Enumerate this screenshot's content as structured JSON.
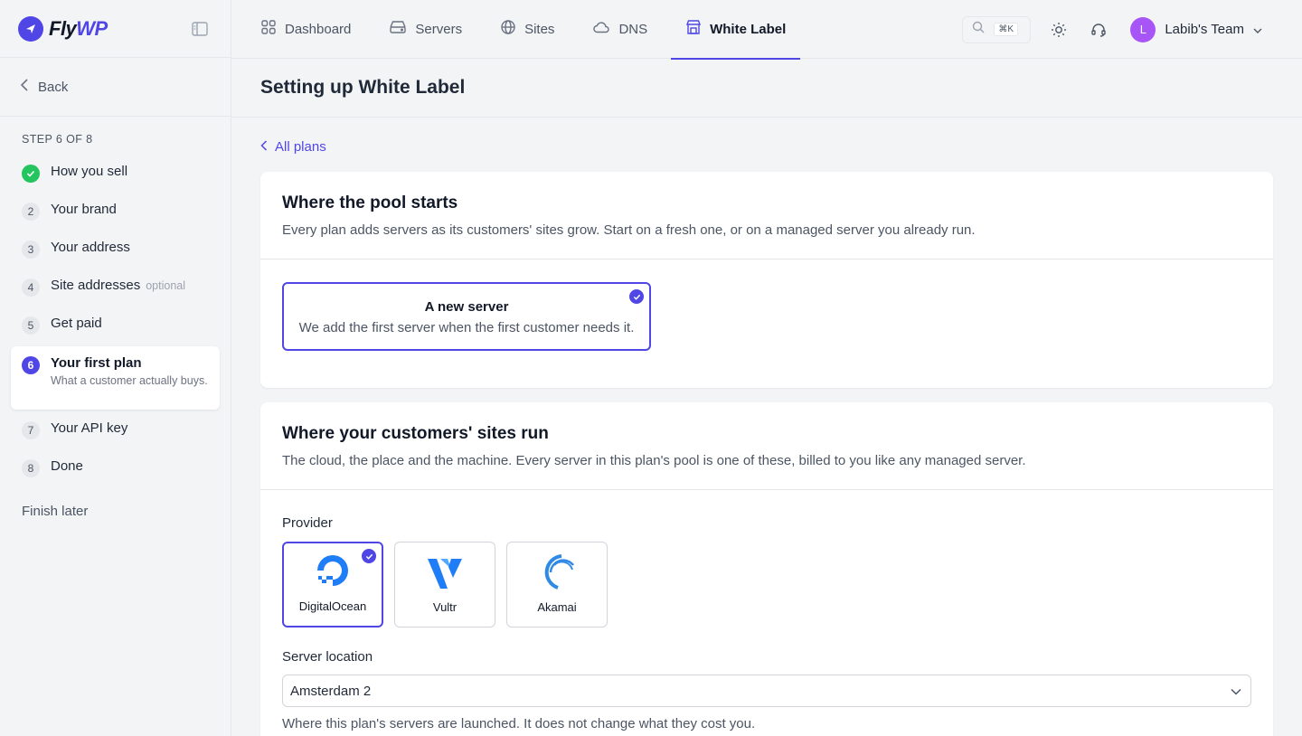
{
  "brand": {
    "name_main": "Fly",
    "name_accent": "WP",
    "accent": "#4f46e5"
  },
  "sidebar": {
    "back_label": "Back",
    "step_count": "STEP 6 OF 8",
    "steps": [
      {
        "num": "",
        "label": "How you sell",
        "state": "done"
      },
      {
        "num": "2",
        "label": "Your brand",
        "state": "todo"
      },
      {
        "num": "3",
        "label": "Your address",
        "state": "todo"
      },
      {
        "num": "4",
        "label": "Site addresses",
        "optional": "optional",
        "state": "todo"
      },
      {
        "num": "5",
        "label": "Get paid",
        "state": "todo"
      },
      {
        "num": "6",
        "label": "Your first plan",
        "sub": "What a customer actually buys.",
        "state": "active"
      },
      {
        "num": "7",
        "label": "Your API key",
        "state": "todo"
      },
      {
        "num": "8",
        "label": "Done",
        "state": "todo"
      }
    ],
    "finish_later": "Finish later"
  },
  "nav": {
    "items": [
      {
        "label": "Dashboard",
        "icon": "dashboard-icon"
      },
      {
        "label": "Servers",
        "icon": "server-icon"
      },
      {
        "label": "Sites",
        "icon": "globe-icon"
      },
      {
        "label": "DNS",
        "icon": "cloud-icon"
      },
      {
        "label": "White Label",
        "icon": "store-icon",
        "active": true
      }
    ],
    "search_shortcut": "⌘K",
    "team_initial": "L",
    "team_name": "Labib's Team"
  },
  "page": {
    "title": "Setting up White Label",
    "all_plans": "All plans"
  },
  "pool": {
    "title": "Where the pool starts",
    "desc": "Every plan adds servers as its customers' sites grow. Start on a fresh one, or on a managed server you already run.",
    "option_title": "A new server",
    "option_desc": "We add the first server when the first customer needs it."
  },
  "sites": {
    "title": "Where your customers' sites run",
    "desc": "The cloud, the place and the machine. Every server in this plan's pool is one of these, billed to you like any managed server.",
    "provider_label": "Provider",
    "providers": [
      {
        "name": "DigitalOcean",
        "selected": true
      },
      {
        "name": "Vultr",
        "selected": false
      },
      {
        "name": "Akamai",
        "selected": false
      }
    ],
    "location_label": "Server location",
    "location_value": "Amsterdam 2",
    "location_hint": "Where this plan's servers are launched. It does not change what they cost you."
  }
}
